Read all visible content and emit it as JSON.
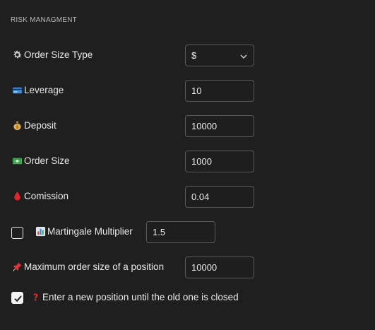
{
  "section": {
    "title": "RISK MANAGMENT"
  },
  "fields": {
    "order_size_type": {
      "label": "Order Size Type",
      "value": "$",
      "icon": "gear-icon"
    },
    "leverage": {
      "label": "Leverage",
      "value": "10",
      "icon": "credit-card-icon"
    },
    "deposit": {
      "label": "Deposit",
      "value": "10000",
      "icon": "money-bag-icon"
    },
    "order_size": {
      "label": "Order Size",
      "value": "1000",
      "icon": "banknote-icon"
    },
    "comission": {
      "label": "Comission",
      "value": "0.04",
      "icon": "drop-icon"
    },
    "martingale": {
      "label": "Martingale Multiplier",
      "value": "1.5",
      "checked": false,
      "icon": "bar-chart-icon"
    },
    "max_order_size": {
      "label": "Maximum order size of a position",
      "value": "10000",
      "icon": "pushpin-icon"
    },
    "new_position": {
      "label": "Enter a new position until the old one is closed",
      "checked": true,
      "icon": "question-mark-icon"
    }
  },
  "colors": {
    "background": "#1f1f1f",
    "text": "#e9e9e9",
    "field_border": "#595959",
    "muted": "#b8b8b8"
  }
}
